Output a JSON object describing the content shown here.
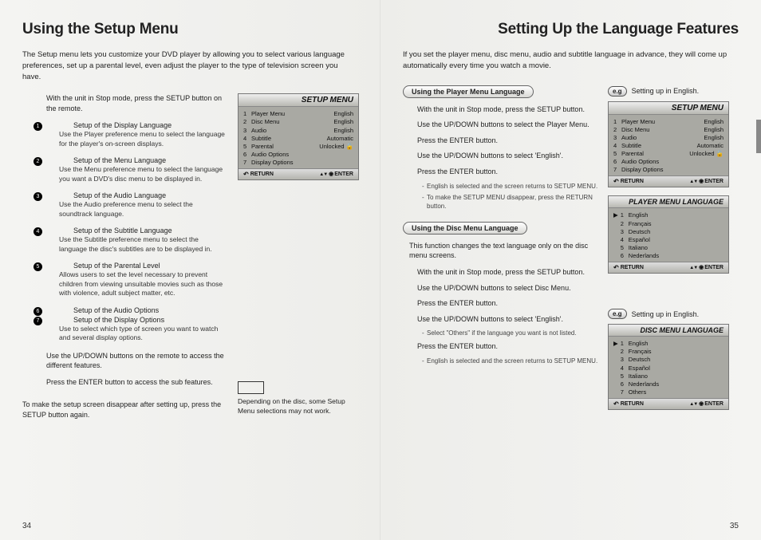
{
  "left": {
    "title": "Using the Setup Menu",
    "intro": "The Setup menu lets you customize your DVD player by allowing you to select various language preferences, set up a parental level, even adjust the player to the type of television screen you have.",
    "stop_note": "With the unit in Stop mode, press the SETUP button on the remote.",
    "items": [
      {
        "title": "Setup of the Display Language",
        "desc": "Use the Player preference menu to select the language for the player's on-screen displays."
      },
      {
        "title": "Setup of the Menu Language",
        "desc": "Use the Menu preference menu to select the language you want a DVD's disc menu to be displayed in."
      },
      {
        "title": "Setup of the Audio Language",
        "desc": "Use the Audio preference menu to select the soundtrack language."
      },
      {
        "title": "Setup of the Subtitle Language",
        "desc": "Use the Subtitle preference menu to select the language the disc's subtitles are to be displayed in."
      },
      {
        "title": "Setup of the Parental Level",
        "desc": "Allows users to set the level necessary to prevent children from viewing unsuitable movies such as those with violence, adult subject matter, etc."
      },
      {
        "title": "Setup of the Audio Options",
        "desc": ""
      },
      {
        "title": "Setup of the Display Options",
        "desc": "Use to select which type of screen you want to watch and several display options."
      }
    ],
    "updown": "Use the UP/DOWN buttons on the remote to access the different features.",
    "press_enter": "Press the ENTER button to access the sub features.",
    "tail": "To make the setup screen disappear after setting up, press the SETUP button again.",
    "note_text": "Depending on the disc, some Setup Menu selections may not work.",
    "page_num": "34"
  },
  "right": {
    "title": "Setting Up the Language Features",
    "intro": "If you set the player menu, disc menu, audio and subtitle language in advance, they will come up automatically every time you watch a movie.",
    "section1_label": "Using the Player Menu Language",
    "section1_steps": [
      "With the unit in Stop mode, press the SETUP button.",
      "Use the UP/DOWN buttons to select the Player Menu.",
      "Press the ENTER button.",
      "Use the UP/DOWN buttons to select 'English'.",
      "Press the ENTER button."
    ],
    "section1_subs": [
      "English is selected and the screen returns to SETUP MENU.",
      "To make the SETUP MENU disappear, press the RETURN button."
    ],
    "section2_label": "Using the Disc Menu Language",
    "section2_intro": "This function changes the text language only on the disc menu screens.",
    "section2_steps": [
      "With the unit in Stop mode, press the SETUP button.",
      "Use the UP/DOWN buttons to select Disc Menu.",
      "Press the ENTER button.",
      "Use the UP/DOWN buttons to select 'English'."
    ],
    "section2_sub1": "Select \"Others\" if the language you want is not listed.",
    "section2_step5": "Press the ENTER button.",
    "section2_sub2": "English is selected and the screen returns to SETUP MENU.",
    "eg_label": "e.g",
    "eg_text": "Setting up in English.",
    "page_num": "35"
  },
  "osd": {
    "setup_title": "SETUP MENU",
    "setup_rows": [
      {
        "n": "1",
        "l": "Player Menu",
        "v": "English"
      },
      {
        "n": "2",
        "l": "Disc Menu",
        "v": "English"
      },
      {
        "n": "3",
        "l": "Audio",
        "v": "English"
      },
      {
        "n": "4",
        "l": "Subtitle",
        "v": "Automatic"
      },
      {
        "n": "5",
        "l": "Parental",
        "v": "Unlocked  🔓"
      },
      {
        "n": "6",
        "l": "Audio Options",
        "v": ""
      },
      {
        "n": "7",
        "l": "Display Options",
        "v": ""
      }
    ],
    "return": "RETURN",
    "enter": "ENTER",
    "player_title": "PLAYER MENU LANGUAGE",
    "player_rows": [
      {
        "n": "1",
        "l": "English"
      },
      {
        "n": "2",
        "l": "Français"
      },
      {
        "n": "3",
        "l": "Deutsch"
      },
      {
        "n": "4",
        "l": "Español"
      },
      {
        "n": "5",
        "l": "Italiano"
      },
      {
        "n": "6",
        "l": "Nederlands"
      }
    ],
    "disc_title": "DISC MENU LANGUAGE",
    "disc_rows": [
      {
        "n": "1",
        "l": "English"
      },
      {
        "n": "2",
        "l": "Français"
      },
      {
        "n": "3",
        "l": "Deutsch"
      },
      {
        "n": "4",
        "l": "Español"
      },
      {
        "n": "5",
        "l": "Italiano"
      },
      {
        "n": "6",
        "l": "Nederlands"
      },
      {
        "n": "7",
        "l": "Others"
      }
    ]
  }
}
